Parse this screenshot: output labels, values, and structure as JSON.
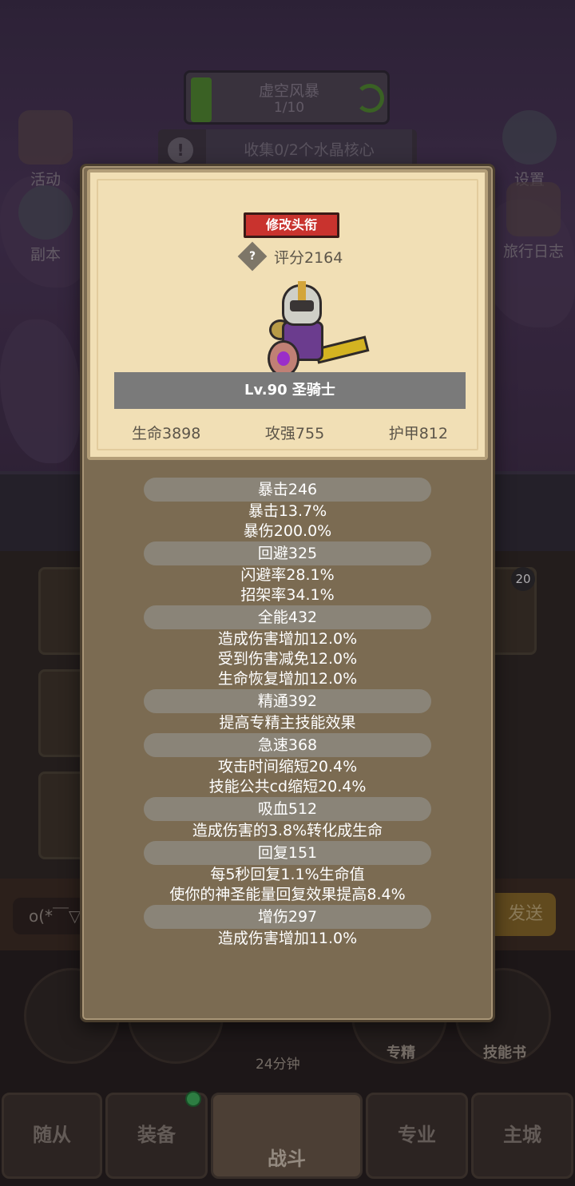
{
  "background": {
    "event_banner": {
      "title": "虚空风暴",
      "progress": "1/10"
    },
    "quest": {
      "text": "收集0/2个水晶核心"
    },
    "left_buttons": [
      "活动",
      "副本"
    ],
    "right_buttons": [
      "设置",
      "旅行日志"
    ],
    "card_badge": "20",
    "chat": {
      "input_text": "o(*￣▽",
      "send_label": "发送"
    },
    "skill_labels": [
      "专精",
      "技能书"
    ],
    "timer": "24分钟",
    "nav_tabs": [
      "随从",
      "装备",
      "战斗",
      "专业",
      "主城"
    ]
  },
  "profile": {
    "title_button": "修改头衔",
    "score": "评分2164",
    "level_class": "Lv.90 圣骑士",
    "stats": {
      "hp": "生命3898",
      "attack": "攻强755",
      "armor": "护甲812"
    }
  },
  "details": [
    {
      "head": "暴击246",
      "lines": [
        "暴击13.7%",
        "暴伤200.0%"
      ]
    },
    {
      "head": "回避325",
      "lines": [
        "闪避率28.1%",
        "招架率34.1%"
      ]
    },
    {
      "head": "全能432",
      "lines": [
        "造成伤害增加12.0%",
        "受到伤害减免12.0%",
        "生命恢复增加12.0%"
      ]
    },
    {
      "head": "精通392",
      "lines": [
        "提高专精主技能效果"
      ]
    },
    {
      "head": "急速368",
      "lines": [
        "攻击时间缩短20.4%",
        "技能公共cd缩短20.4%"
      ]
    },
    {
      "head": "吸血512",
      "lines": [
        "造成伤害的3.8%转化成生命"
      ]
    },
    {
      "head": "回复151",
      "lines": [
        "每5秒回复1.1%生命值",
        "使你的神圣能量回复效果提高8.4%"
      ]
    },
    {
      "head": "增伤297",
      "lines": [
        "造成伤害增加11.0%"
      ]
    }
  ]
}
